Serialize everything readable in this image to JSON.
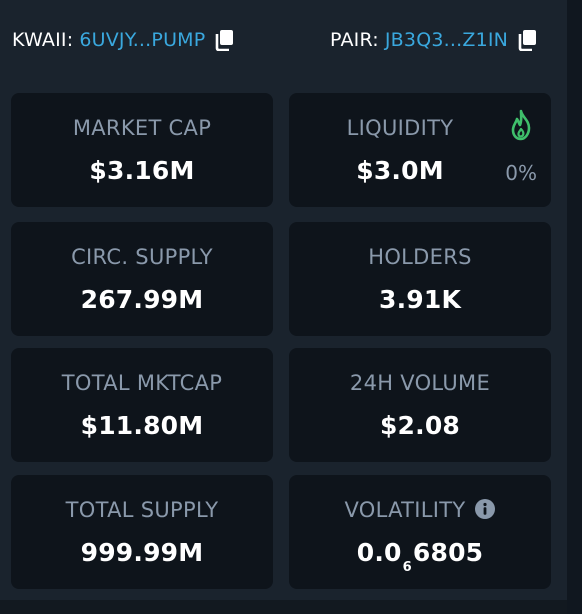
{
  "header": {
    "token_label": "KWAII:",
    "token_address": "6UVJY...PUMP",
    "pair_label": "PAIR:",
    "pair_address": "JB3Q3...Z1IN"
  },
  "stats": {
    "market_cap": {
      "title": "MARKET CAP",
      "value": "$3.16M"
    },
    "liquidity": {
      "title": "LIQUIDITY",
      "value": "$3.0M",
      "change": "0%"
    },
    "circ_supply": {
      "title": "CIRC. SUPPLY",
      "value": "267.99M"
    },
    "holders": {
      "title": "HOLDERS",
      "value": "3.91K"
    },
    "total_mktcap": {
      "title": "TOTAL MKTCAP",
      "value": "$11.80M"
    },
    "volume_24h": {
      "title": "24H VOLUME",
      "value": "$2.08"
    },
    "total_supply": {
      "title": "TOTAL SUPPLY",
      "value": "999.99M"
    },
    "volatility": {
      "title": "VOLATILITY",
      "value_prefix": "0.0",
      "value_subscript": "6",
      "value_suffix": "6805"
    }
  },
  "icons": {
    "copy": "copy-icon",
    "liquidity_flame": "flame-icon",
    "info": "info-icon"
  },
  "colors": {
    "address": "#3aa8de",
    "flame": "#3fbf6b",
    "muted": "#8a99ab"
  }
}
